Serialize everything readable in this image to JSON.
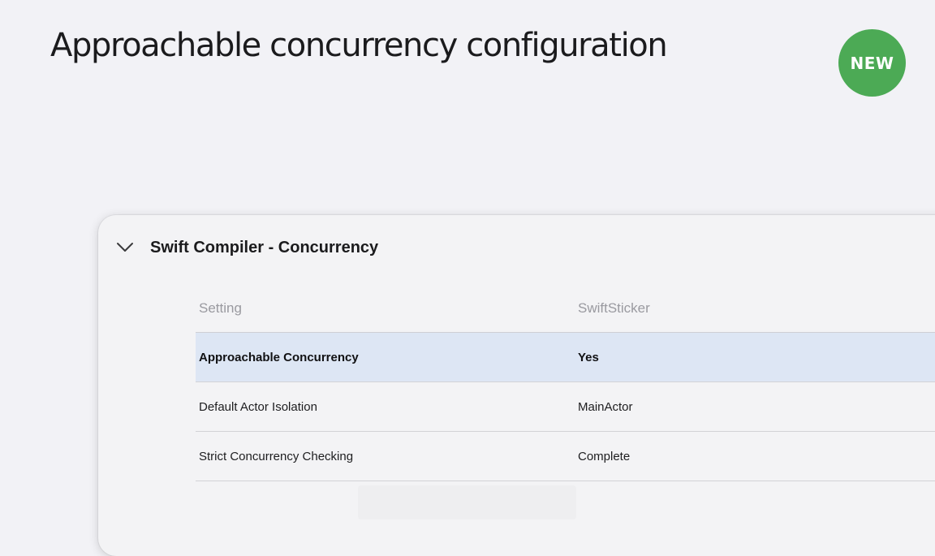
{
  "title": "Approachable concurrency configuration",
  "badge": "NEW",
  "colors": {
    "badge": "#4caa55",
    "selected_row": "#dde6f4",
    "background": "#f2f2f6"
  },
  "section": {
    "title": "Swift Compiler - Concurrency",
    "expanded": true,
    "icon": "chevron-down-icon"
  },
  "table": {
    "columns": [
      "Setting",
      "SwiftSticker"
    ],
    "rows": [
      {
        "setting": "Approachable Concurrency",
        "value": "Yes",
        "selected": true
      },
      {
        "setting": "Default Actor Isolation",
        "value": "MainActor",
        "selected": false
      },
      {
        "setting": "Strict Concurrency Checking",
        "value": "Complete",
        "selected": false
      }
    ]
  }
}
